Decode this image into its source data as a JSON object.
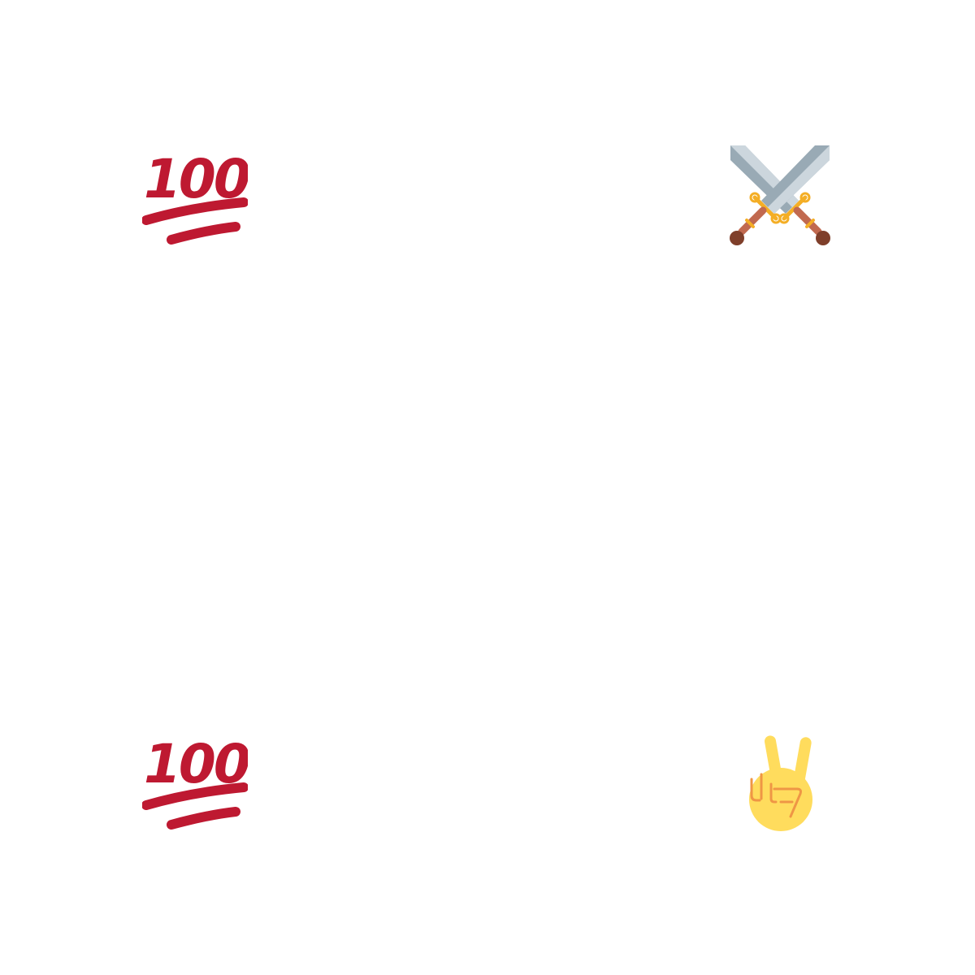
{
  "emojis": [
    {
      "name": "hundred-points-icon",
      "text": "100",
      "color": "#be1931"
    },
    {
      "name": "crossed-swords-icon",
      "blade": "#99aab5",
      "guard": "#f4ae25",
      "grip": "#c1694f",
      "pommel": "#7f3f2a"
    },
    {
      "name": "hundred-points-icon",
      "text": "100",
      "color": "#be1931"
    },
    {
      "name": "victory-hand-icon",
      "skin": "#ffdc5d",
      "line": "#ef9645"
    }
  ]
}
